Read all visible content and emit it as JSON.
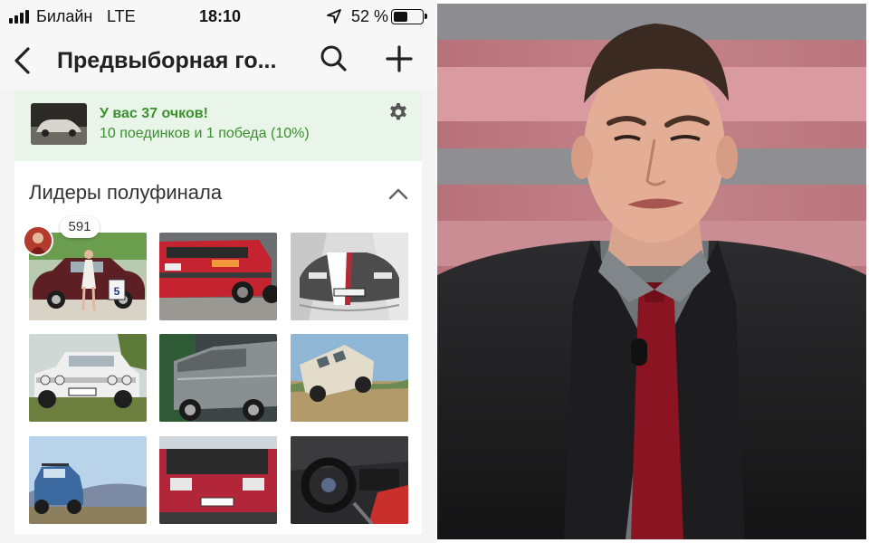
{
  "status_bar": {
    "carrier": "Билайн",
    "network": "LTE",
    "time": "18:10",
    "battery_percent": "52 %",
    "battery_level": 0.52,
    "icons": [
      "signal-icon",
      "location-arrow-icon",
      "battery-icon"
    ]
  },
  "nav": {
    "title": "Предвыборная го...",
    "icons": [
      "back-chevron-icon",
      "search-icon",
      "plus-icon"
    ]
  },
  "score": {
    "headline": "У вас 37 очков!",
    "detail": "10 поединков и 1 победа (10%)",
    "icon": "gear-icon"
  },
  "leaders": {
    "heading": "Лидеры полуфинала",
    "collapse_icon": "chevron-up-icon",
    "top_votes": "591",
    "tiles": [
      {
        "subject": "maroon-sedan-with-girl",
        "plate_number": "5"
      },
      {
        "subject": "red-hatchback-rear"
      },
      {
        "subject": "bmw-front-bw-red"
      },
      {
        "subject": "white-lada-classic"
      },
      {
        "subject": "grey-wagon-side"
      },
      {
        "subject": "uaz-van-offroad"
      },
      {
        "subject": "blue-niva-mountains"
      },
      {
        "subject": "red-subaru-rear"
      },
      {
        "subject": "bmw-interior"
      }
    ]
  },
  "colors": {
    "accent_green": "#3a8f2e",
    "score_bg": "#e9f5e8",
    "bar_bg": "#f7f7f7"
  },
  "photo": {
    "subject": "man-in-dark-suit-red-tie"
  }
}
